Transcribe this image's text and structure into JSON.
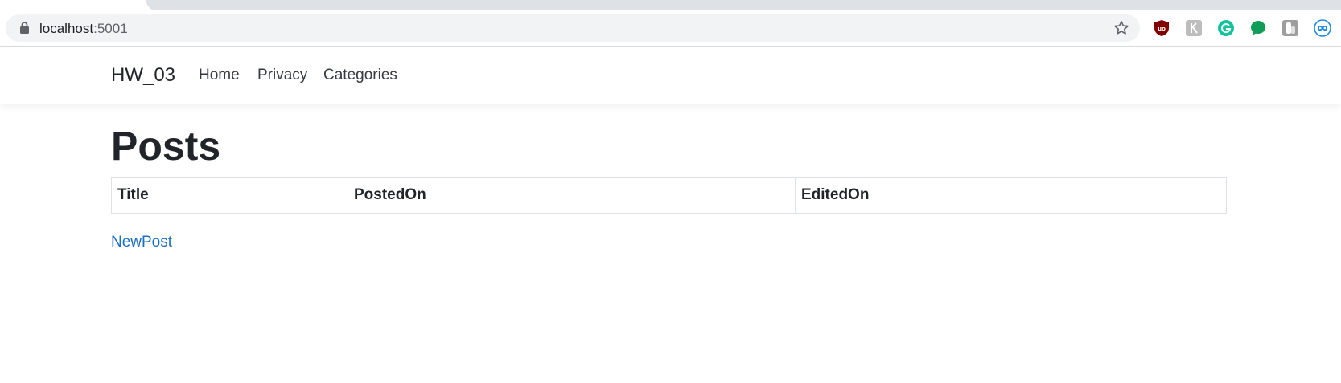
{
  "browser": {
    "url_host": "localhost",
    "url_port": ":5001",
    "icons": [
      "lock-icon",
      "bookmark-star-icon"
    ],
    "extensions": [
      {
        "name": "ublock-extension-icon",
        "color": "#800000"
      },
      {
        "name": "extension-gray-icon",
        "color": "#bdbdbd"
      },
      {
        "name": "grammarly-extension-icon",
        "color": "#15c39a"
      },
      {
        "name": "chat-extension-icon",
        "color": "#0f9d58"
      },
      {
        "name": "hand-extension-icon",
        "color": "#9e9e9e"
      },
      {
        "name": "infinity-extension-icon",
        "color": "#1e88e5"
      }
    ]
  },
  "navbar": {
    "brand": "HW_03",
    "links": [
      "Home",
      "Privacy",
      "Categories"
    ]
  },
  "main": {
    "title": "Posts",
    "table": {
      "columns": [
        "Title",
        "PostedOn",
        "EditedOn"
      ],
      "rows": []
    },
    "new_post_link": "NewPost"
  },
  "colors": {
    "link": "#1b6ec2",
    "text": "#212529",
    "border": "#dee2e6"
  }
}
